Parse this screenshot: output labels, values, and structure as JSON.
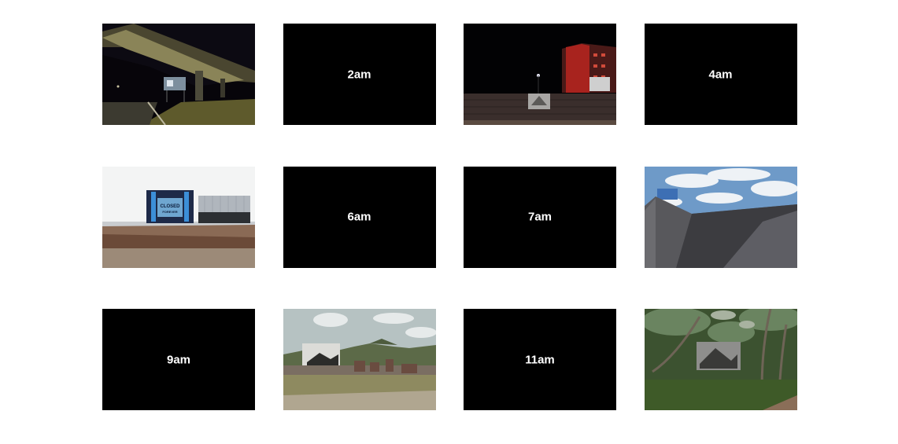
{
  "tiles": [
    {
      "id": "1am",
      "kind": "photo",
      "photo": "overpass-night-billboard-photo"
    },
    {
      "id": "2am",
      "kind": "label",
      "label": "2am"
    },
    {
      "id": "3am",
      "kind": "photo",
      "photo": "red-building-night-billboard-photo"
    },
    {
      "id": "4am",
      "kind": "label",
      "label": "4am"
    },
    {
      "id": "5am",
      "kind": "photo",
      "photo": "closed-forever-billboard-photo",
      "sign_text_1": "CLOSED",
      "sign_text_2": "FOREVER"
    },
    {
      "id": "6am",
      "kind": "label",
      "label": "6am"
    },
    {
      "id": "7am",
      "kind": "label",
      "label": "7am"
    },
    {
      "id": "8am",
      "kind": "photo",
      "photo": "rooftop-sky-photo"
    },
    {
      "id": "9am",
      "kind": "label",
      "label": "9am"
    },
    {
      "id": "10am",
      "kind": "photo",
      "photo": "hills-billboard-photo"
    },
    {
      "id": "11am",
      "kind": "label",
      "label": "11am"
    },
    {
      "id": "12pm",
      "kind": "photo",
      "photo": "forest-billboard-photo"
    }
  ],
  "colors": {
    "tile_bg": "#000000",
    "label_text": "#ffffff",
    "page_bg": "#ffffff"
  }
}
